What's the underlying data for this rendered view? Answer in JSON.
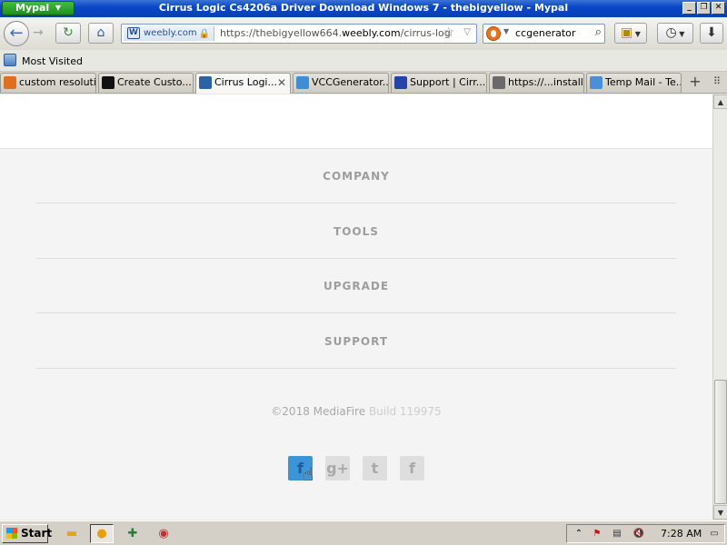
{
  "window": {
    "app_menu_label": "Mypal",
    "title": "Cirrus Logic Cs4206a Driver Download Windows 7 - thebigyellow - Mypal"
  },
  "navbar": {
    "identity_domain": "weebly.com",
    "url_prefix": "https://thebigyellow664.",
    "url_host": "weebly.com",
    "url_path": "/cirrus-logic-c",
    "search_value": "ccgenerator"
  },
  "bookmarks": {
    "most_visited_label": "Most Visited"
  },
  "tabs": [
    {
      "label": "custom resoluti...",
      "icon": "mypal-icon",
      "fav_color": "#e07020",
      "active": false
    },
    {
      "label": "Create Custo...",
      "icon": "black-logo-icon",
      "fav_color": "#111111",
      "active": false
    },
    {
      "label": "Cirrus Logi...",
      "icon": "weebly-icon",
      "fav_color": "#2e62a8",
      "active": true
    },
    {
      "label": "VCCGenerator...",
      "icon": "v-icon",
      "fav_color": "#3e8ed6",
      "active": false
    },
    {
      "label": "Support | Cirr...",
      "icon": "support-icon",
      "fav_color": "#2644a8",
      "active": false
    },
    {
      "label": "https://...install/",
      "icon": "tools-icon",
      "fav_color": "#6a6a6a",
      "active": false
    },
    {
      "label": "Temp Mail - Te...",
      "icon": "mail-icon",
      "fav_color": "#4c8fd8",
      "active": false
    }
  ],
  "footer": {
    "links": [
      "COMPANY",
      "TOOLS",
      "UPGRADE",
      "SUPPORT"
    ],
    "copyright": "©2018 MediaFire",
    "build": "Build 119975",
    "social": [
      {
        "name": "facebook-icon",
        "glyph": "f"
      },
      {
        "name": "google-plus-icon",
        "glyph": "g+"
      },
      {
        "name": "twitter-icon",
        "glyph": "t"
      },
      {
        "name": "facebook-alt-icon",
        "glyph": "f"
      }
    ]
  },
  "taskbar": {
    "start_label": "Start",
    "clock": "7:28 AM"
  },
  "colors": {
    "titlebar": "#0a47c7",
    "social_active": "#3d95d9",
    "footer_text": "#9d9d9d"
  }
}
